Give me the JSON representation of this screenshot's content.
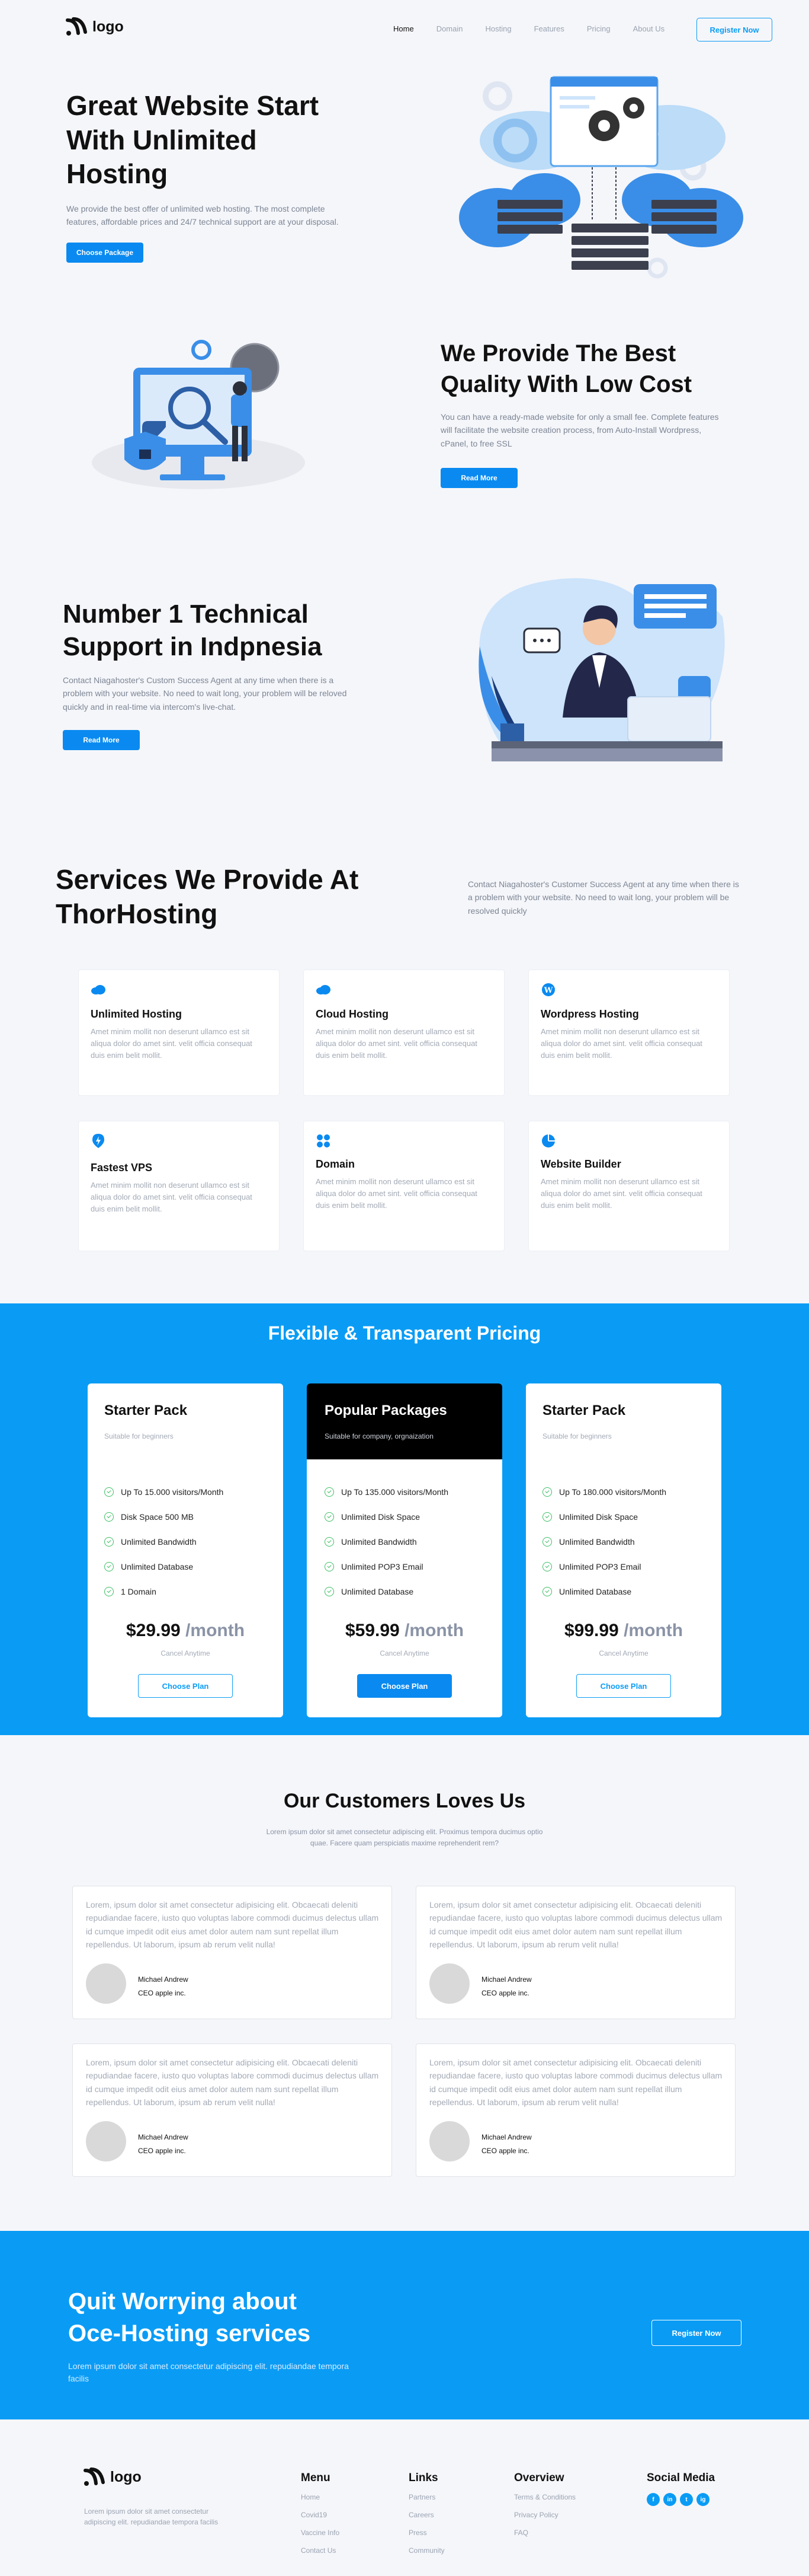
{
  "header": {
    "logo_text": "logo",
    "nav": [
      "Home",
      "Domain",
      "Hosting",
      "Features",
      "Pricing",
      "About Us"
    ],
    "register_label": "Register Now"
  },
  "hero": {
    "title_line1": "Great Website Start",
    "title_line2": "With Unlimited",
    "title_line3": "Hosting",
    "description": "We provide the best offer of unlimited web hosting. The most complete features, affordable prices and 24/7 technical support are at your disposal.",
    "button_label": "Choose Package"
  },
  "quality": {
    "title_line1": "We Provide The Best",
    "title_line2": "Quality With Low Cost",
    "description": "You can have a ready-made website for only a small fee. Complete features will facilitate the website creation process, from Auto-Install Wordpress, cPanel, to free SSL",
    "button_label": "Read More"
  },
  "support": {
    "title_line1": "Number 1 Technical",
    "title_line2": "Support in Indpnesia",
    "description": "Contact Niagahoster's Custom Success Agent at any time when there is a problem with your website. No need to wait long, your problem will be reloved quickly and in real-time via intercom's live-chat.",
    "button_label": "Read More"
  },
  "services": {
    "title_line1": "Services We Provide At",
    "title_line2": "ThorHosting",
    "description": "Contact Niagahoster's Customer Success Agent at any time when there is a problem with your website. No need to wait long, your problem will be resolved quickly",
    "items": [
      {
        "title": "Unlimited Hosting",
        "desc": "Amet minim mollit non deserunt ullamco est sit aliqua dolor do amet sint. velit officia consequat duis enim belit mollit.",
        "icon": "cloud-icon"
      },
      {
        "title": "Cloud Hosting",
        "desc": "Amet minim mollit non deserunt ullamco est sit aliqua dolor do amet sint. velit officia consequat duis enim belit mollit.",
        "icon": "cloud-icon"
      },
      {
        "title": "Wordpress Hosting",
        "desc": "Amet minim mollit non deserunt ullamco est sit aliqua dolor do amet sint. velit officia consequat duis enim belit mollit.",
        "icon": "wordpress-icon"
      },
      {
        "title": "Fastest VPS",
        "desc": "Amet minim mollit non deserunt ullamco est sit aliqua dolor do amet sint. velit officia consequat duis enim belit mollit.",
        "icon": "lightning-icon"
      },
      {
        "title": "Domain",
        "desc": "Amet minim mollit non deserunt ullamco est sit aliqua dolor do amet sint. velit officia consequat duis enim belit mollit.",
        "icon": "grid-icon"
      },
      {
        "title": "Website Builder",
        "desc": "Amet minim mollit non deserunt ullamco est sit aliqua dolor do amet sint. velit officia consequat duis enim belit mollit.",
        "icon": "pie-icon"
      }
    ]
  },
  "pricing": {
    "title": "Flexible & Transparent Pricing",
    "plans": [
      {
        "name": "Starter Pack",
        "subtitle": "Suitable for beginners",
        "features": [
          "Up To 15.000 visitors/Month",
          "Disk Space 500 MB",
          "Unlimited Bandwidth",
          "Unlimited Database",
          "1 Domain"
        ],
        "price": "$29.99",
        "period": "/month",
        "cancel": "Cancel Anytime",
        "button": "Choose Plan"
      },
      {
        "name": "Popular Packages",
        "subtitle": "Suitable for company, orgnaization",
        "features": [
          "Up To 135.000 visitors/Month",
          "Unlimited Disk Space",
          "Unlimited Bandwidth",
          "Unlimited POP3 Email",
          "Unlimited Database"
        ],
        "price": "$59.99",
        "period": "/month",
        "cancel": "Cancel Anytime",
        "button": "Choose Plan"
      },
      {
        "name": "Starter Pack",
        "subtitle": "Suitable for beginners",
        "features": [
          "Up To 180.000 visitors/Month",
          "Unlimited Disk Space",
          "Unlimited Bandwidth",
          "Unlimited POP3 Email",
          "Unlimited Database"
        ],
        "price": "$99.99",
        "period": "/month",
        "cancel": "Cancel Anytime",
        "button": "Choose Plan"
      }
    ]
  },
  "testimonials": {
    "title": "Our Customers Loves Us",
    "subtitle": "Lorem ipsum dolor sit amet consectetur adipiscing elit. Proximus tempora ducimus optio quae. Facere quam perspiciatis maxime reprehenderit rem?",
    "items": [
      {
        "text": "Lorem, ipsum dolor sit amet consectetur adipisicing elit. Obcaecati deleniti repudiandae facere, iusto quo voluptas labore commodi ducimus delectus ullam id cumque impedit odit eius amet dolor autem nam sunt repellat illum repellendus. Ut laborum, ipsum ab rerum velit nulla!",
        "name": "Michael Andrew",
        "role": "CEO apple inc."
      },
      {
        "text": "Lorem, ipsum dolor sit amet consectetur adipisicing elit. Obcaecati deleniti repudiandae facere, iusto quo voluptas labore commodi ducimus delectus ullam id cumque impedit odit eius amet dolor autem nam sunt repellat illum repellendus. Ut laborum, ipsum ab rerum velit nulla!",
        "name": "Michael Andrew",
        "role": "CEO apple inc."
      },
      {
        "text": "Lorem, ipsum dolor sit amet consectetur adipisicing elit. Obcaecati deleniti repudiandae facere, iusto quo voluptas labore commodi ducimus delectus ullam id cumque impedit odit eius amet dolor autem nam sunt repellat illum repellendus. Ut laborum, ipsum ab rerum velit nulla!",
        "name": "Michael Andrew",
        "role": "CEO apple inc."
      },
      {
        "text": "Lorem, ipsum dolor sit amet consectetur adipisicing elit. Obcaecati deleniti repudiandae facere, iusto quo voluptas labore commodi ducimus delectus ullam id cumque impedit odit eius amet dolor autem nam sunt repellat illum repellendus. Ut laborum, ipsum ab rerum velit nulla!",
        "name": "Michael Andrew",
        "role": "CEO apple inc."
      }
    ]
  },
  "cta": {
    "title_line1": "Quit Worrying about",
    "title_line2": "Oce-Hosting services",
    "description": "Lorem ipsum dolor sit amet consectetur adipiscing elit. repudiandae tempora facilis",
    "button_label": "Register Now"
  },
  "footer": {
    "logo_text": "logo",
    "tagline": "Lorem ipsum dolor sit amet consectetur adipiscing elit. repudiandae tempora facilis",
    "columns": [
      {
        "heading": "Menu",
        "links": [
          "Home",
          "Covid19",
          "Vaccine Info",
          "Contact Us"
        ]
      },
      {
        "heading": "Links",
        "links": [
          "Partners",
          "Careers",
          "Press",
          "Community"
        ]
      },
      {
        "heading": "Overview",
        "links": [
          "Terms & Conditions",
          "Privacy Policy",
          "FAQ"
        ]
      }
    ],
    "social_heading": "Social Media",
    "social": [
      "f",
      "in",
      "t",
      "ig"
    ]
  },
  "colors": {
    "accent": "#0a9cf5",
    "button": "#0a8af0",
    "dark_card": "#000000",
    "check": "#3fbf65"
  }
}
